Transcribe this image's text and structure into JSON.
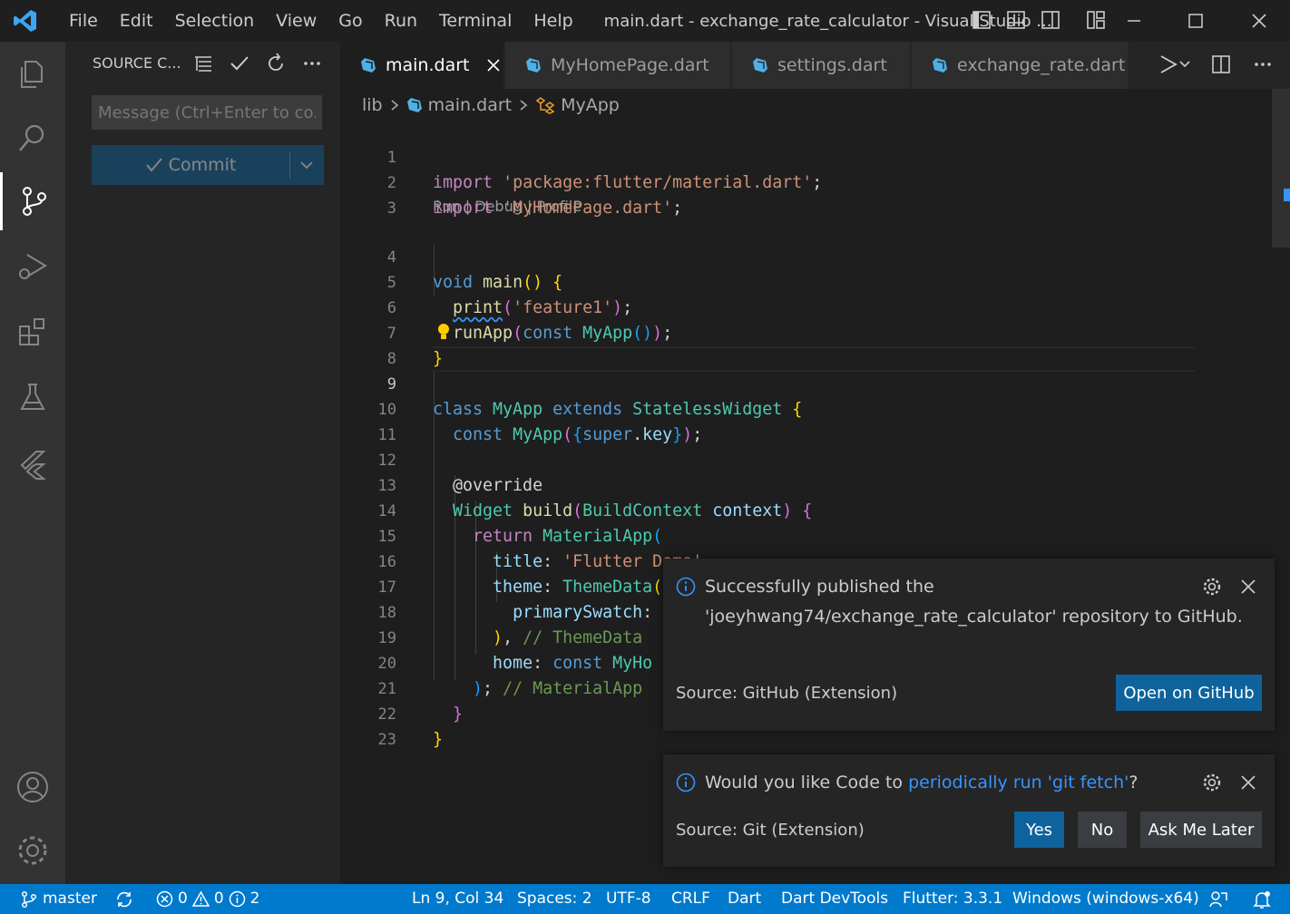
{
  "menu": [
    "File",
    "Edit",
    "Selection",
    "View",
    "Go",
    "Run",
    "Terminal",
    "Help"
  ],
  "window_title": "main.dart - exchange_rate_calculator - Visual Studio ...",
  "sidebar": {
    "header": "SOURCE C...",
    "message_placeholder": "Message (Ctrl+Enter to co...",
    "commit_label": "Commit"
  },
  "tabs": [
    "main.dart",
    "MyHomePage.dart",
    "settings.dart",
    "exchange_rate.dart"
  ],
  "breadcrumb": {
    "folder": "lib",
    "file": "main.dart",
    "symbol": "MyApp"
  },
  "codelens": "Run | Debug | Profile",
  "line_numbers": [
    "1",
    "2",
    "3",
    "4",
    "5",
    "6",
    "7",
    "8",
    "9",
    "10",
    "11",
    "12",
    "13",
    "14",
    "15",
    "16",
    "17",
    "18",
    "19",
    "20",
    "21",
    "22",
    "23"
  ],
  "code": {
    "l1": {
      "kw": "import",
      "str": "'package:flutter/material.dart'",
      "end": ";"
    },
    "l2": {
      "kw": "import",
      "str": "'MyHomePage.dart'",
      "end": ";"
    },
    "l4": {
      "kw": "void",
      "fn": "main",
      "par": "()",
      "br": "{"
    },
    "l5": {
      "fn": "print",
      "o": "(",
      "str": "'feature1'",
      "c": ")",
      "end": ";"
    },
    "l6": {
      "fn": "runApp",
      "o": "(",
      "kw": "const",
      "ty": "MyApp",
      "p": "()",
      "c": ")",
      "end": ";"
    },
    "l7": {
      "br": "}"
    },
    "l9": {
      "kw": "class",
      "ty": "MyApp",
      "kw2": "extends",
      "ty2": "StatelessWidget",
      "br": "{"
    },
    "l10": {
      "kw": "const",
      "ty": "MyApp",
      "o": "(",
      "b": "{",
      "kw2": "super",
      "dot": ".",
      "var": "key",
      "bc": "}",
      "c": ")",
      "end": ";"
    },
    "l12": {
      "dec": "@override"
    },
    "l13": {
      "ty": "Widget",
      "fn": "build",
      "o": "(",
      "ty2": "BuildContext",
      "var": "context",
      "c": ")",
      "br": "{"
    },
    "l14": {
      "ctl": "return",
      "ty": "MaterialApp",
      "o": "("
    },
    "l15": {
      "var": "title",
      "colon": ":",
      "str": "'Flutter Demo'",
      "end": ","
    },
    "l16": {
      "var": "theme",
      "colon": ":",
      "ty": "ThemeData",
      "o": "("
    },
    "l17": {
      "var": "primarySwatch",
      "colon": ":"
    },
    "l18": {
      "c": ")",
      "end": ",",
      "cm": "// ThemeData"
    },
    "l19": {
      "var": "home",
      "colon": ":",
      "kw": "const",
      "ty": "MyHo"
    },
    "l20": {
      "c": ")",
      "end": ";",
      "cm": "// MaterialApp"
    },
    "l21": {
      "br": "}"
    },
    "l22": {
      "br": "}"
    }
  },
  "toast1": {
    "line1": "Successfully published the",
    "line2": "'joeyhwang74/exchange_rate_calculator' repository to GitHub.",
    "source": "Source: GitHub (Extension)",
    "button": "Open on GitHub"
  },
  "toast2": {
    "text_before": "Would you like Code to ",
    "link": "periodically run 'git fetch'",
    "text_after": "?",
    "source": "Source: Git (Extension)",
    "yes": "Yes",
    "no": "No",
    "later": "Ask Me Later"
  },
  "status": {
    "branch": "master",
    "errors": "0",
    "warnings": "0",
    "infos": "2",
    "position": "Ln 9, Col 34",
    "spaces": "Spaces: 2",
    "encoding": "UTF-8",
    "eol": "CRLF",
    "language": "Dart",
    "devtools": "Dart DevTools",
    "flutter": "Flutter: 3.3.1",
    "device": "Windows (windows-x64)"
  },
  "colors": {
    "accent": "#007acc",
    "button": "#0e639c",
    "link": "#3794ff"
  }
}
